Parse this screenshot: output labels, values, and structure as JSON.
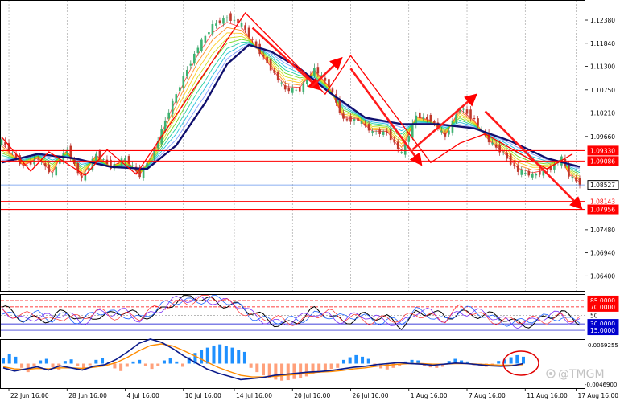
{
  "chart_data": {
    "type": "candlestick",
    "main": {
      "ylim": [
        1.0605,
        1.1285
      ],
      "y_ticks": [
        "1.12380",
        "1.11840",
        "1.11300",
        "1.10750",
        "1.10210",
        "1.09660",
        "1.08527",
        "1.07480",
        "1.06940",
        "1.06400"
      ],
      "current_price": "1.08527",
      "levels": [
        {
          "label": "1.09330",
          "value": 1.0933,
          "style": "box"
        },
        {
          "label": "1.09086",
          "value": 1.09086,
          "style": "box"
        },
        {
          "label": "1.08143",
          "value": 1.08143,
          "style": "text"
        },
        {
          "label": "1.07956",
          "value": 1.07956,
          "style": "box"
        }
      ],
      "price_path": [
        {
          "i": 0,
          "p": 1.0955
        },
        {
          "i": 6,
          "p": 1.0895
        },
        {
          "i": 10,
          "p": 1.0915
        },
        {
          "i": 14,
          "p": 1.0875
        },
        {
          "i": 16,
          "p": 1.0915
        },
        {
          "i": 18,
          "p": 1.0935
        },
        {
          "i": 22,
          "p": 1.0865
        },
        {
          "i": 26,
          "p": 1.0925
        },
        {
          "i": 30,
          "p": 1.0895
        },
        {
          "i": 34,
          "p": 1.0915
        },
        {
          "i": 38,
          "p": 1.0875
        },
        {
          "i": 42,
          "p": 1.0935
        },
        {
          "i": 46,
          "p": 1.1025
        },
        {
          "i": 50,
          "p": 1.1105
        },
        {
          "i": 54,
          "p": 1.1175
        },
        {
          "i": 58,
          "p": 1.1225
        },
        {
          "i": 62,
          "p": 1.1245
        },
        {
          "i": 66,
          "p": 1.1228
        },
        {
          "i": 70,
          "p": 1.1175
        },
        {
          "i": 74,
          "p": 1.1125
        },
        {
          "i": 78,
          "p": 1.1075
        },
        {
          "i": 82,
          "p": 1.1075
        },
        {
          "i": 86,
          "p": 1.1125
        },
        {
          "i": 90,
          "p": 1.1085
        },
        {
          "i": 94,
          "p": 1.1005
        },
        {
          "i": 98,
          "p": 1.1005
        },
        {
          "i": 102,
          "p": 1.0975
        },
        {
          "i": 106,
          "p": 1.0975
        },
        {
          "i": 110,
          "p": 1.0925
        },
        {
          "i": 114,
          "p": 1.1015
        },
        {
          "i": 118,
          "p": 1.1005
        },
        {
          "i": 122,
          "p": 1.0965
        },
        {
          "i": 126,
          "p": 1.1035
        },
        {
          "i": 130,
          "p": 1.1005
        },
        {
          "i": 134,
          "p": 1.0955
        },
        {
          "i": 138,
          "p": 1.0925
        },
        {
          "i": 142,
          "p": 1.0885
        },
        {
          "i": 146,
          "p": 1.0875
        },
        {
          "i": 150,
          "p": 1.0885
        },
        {
          "i": 154,
          "p": 1.0915
        },
        {
          "i": 156,
          "p": 1.0875
        },
        {
          "i": 159,
          "p": 1.0855
        }
      ],
      "ma_path": [
        {
          "i": 0,
          "p": 1.0905
        },
        {
          "i": 10,
          "p": 1.0925
        },
        {
          "i": 20,
          "p": 1.0915
        },
        {
          "i": 30,
          "p": 1.0895
        },
        {
          "i": 40,
          "p": 1.089
        },
        {
          "i": 48,
          "p": 1.0945
        },
        {
          "i": 56,
          "p": 1.1045
        },
        {
          "i": 62,
          "p": 1.1135
        },
        {
          "i": 68,
          "p": 1.118
        },
        {
          "i": 74,
          "p": 1.1165
        },
        {
          "i": 82,
          "p": 1.1125
        },
        {
          "i": 90,
          "p": 1.107
        },
        {
          "i": 100,
          "p": 1.101
        },
        {
          "i": 110,
          "p": 1.0995
        },
        {
          "i": 120,
          "p": 1.0995
        },
        {
          "i": 130,
          "p": 1.0985
        },
        {
          "i": 140,
          "p": 1.0955
        },
        {
          "i": 150,
          "p": 1.0915
        },
        {
          "i": 159,
          "p": 1.0895
        }
      ],
      "zigzag": [
        {
          "i": 0,
          "p": 1.0965
        },
        {
          "i": 8,
          "p": 1.0885
        },
        {
          "i": 13,
          "p": 1.093
        },
        {
          "i": 23,
          "p": 1.0875
        },
        {
          "i": 29,
          "p": 1.0935
        },
        {
          "i": 37,
          "p": 1.0878
        },
        {
          "i": 67,
          "p": 1.1255
        },
        {
          "i": 89,
          "p": 1.1065
        },
        {
          "i": 96,
          "p": 1.1155
        },
        {
          "i": 118,
          "p": 1.0905
        },
        {
          "i": 126,
          "p": 1.095
        },
        {
          "i": 133,
          "p": 1.0972
        },
        {
          "i": 150,
          "p": 1.089
        },
        {
          "i": 157,
          "p": 1.0925
        }
      ],
      "arrows": [
        {
          "from": {
            "i": 69,
            "p": 1.122
          },
          "to": {
            "i": 87,
            "p": 1.108
          }
        },
        {
          "from": {
            "i": 85,
            "p": 1.108
          },
          "to": {
            "i": 93,
            "p": 1.1145
          }
        },
        {
          "from": {
            "i": 96,
            "p": 1.1125
          },
          "to": {
            "i": 115,
            "p": 1.0905
          }
        },
        {
          "from": {
            "i": 113,
            "p": 1.0935
          },
          "to": {
            "i": 130,
            "p": 1.106
          }
        },
        {
          "from": {
            "i": 133,
            "p": 1.1025
          },
          "to": {
            "i": 159,
            "p": 1.0802
          }
        }
      ]
    },
    "oscillator": {
      "ylim": [
        0,
        100
      ],
      "levels": [
        {
          "label": "85.0000",
          "value": 85,
          "style": "box"
        },
        {
          "label": "70.0000",
          "value": 70,
          "style": "box"
        },
        {
          "label": "50",
          "value": 50,
          "style": "text"
        },
        {
          "label": "30.0000",
          "value": 30,
          "style": "box"
        },
        {
          "label": "15.0000",
          "value": 15,
          "style": "box"
        }
      ]
    },
    "macd": {
      "ylim": [
        -0.0046,
        0.0046
      ],
      "y_ticks": [
        "0.0069255",
        "-0.0046900"
      ],
      "histogram": [
        0.001,
        0.0018,
        0.0013,
        -0.0008,
        -0.0016,
        -0.0004,
        0.0006,
        0.0009,
        -0.0007,
        -0.0012,
        0.0005,
        0.0008,
        -0.0005,
        -0.0011,
        -0.0003,
        0.0007,
        0.001,
        0.0003,
        -0.0009,
        -0.0014,
        -0.0006,
        0.0004,
        0.0007,
        -0.0004,
        -0.001,
        -0.0005,
        0.0006,
        0.001,
        0.0004,
        -0.0006,
        0.0012,
        0.002,
        0.0026,
        0.003,
        0.0034,
        0.0036,
        0.0033,
        0.003,
        0.0026,
        0.0022,
        -0.0008,
        -0.0016,
        -0.0022,
        -0.0027,
        -0.003,
        -0.0032,
        -0.0031,
        -0.0029,
        -0.0027,
        -0.0024,
        -0.002,
        -0.0017,
        -0.0013,
        -0.001,
        -0.0008,
        0.0007,
        0.0012,
        0.0016,
        0.0013,
        0.0009,
        -0.0006,
        -0.0009,
        -0.0011,
        -0.0008,
        -0.0005,
        0.0004,
        0.0007,
        0.0006,
        -0.0004,
        -0.0007,
        -0.0008,
        -0.0006,
        0.0005,
        0.0009,
        0.0006,
        0.0004,
        -0.0003,
        -0.0005,
        -0.0006,
        -0.0004,
        0.0005,
        0.0008,
        0.0012,
        0.0016,
        0.0013
      ],
      "line1": [
        -0.0008,
        -0.0014,
        -0.001,
        -0.0006,
        -0.0012,
        -0.0004,
        -0.0008,
        -0.0012,
        -0.0005,
        -0.0002,
        0.0008,
        0.0022,
        0.0038,
        0.0046,
        0.004,
        0.0028,
        0.0014,
        0.0002,
        -0.001,
        -0.0018,
        -0.0024,
        -0.003,
        -0.0028,
        -0.0026,
        -0.0022,
        -0.002,
        -0.0018,
        -0.0016,
        -0.0015,
        -0.0013,
        -0.001,
        -0.0007,
        -0.0005,
        -0.0002,
        0.0,
        0.0002,
        0.0,
        -0.0001,
        -0.0003,
        -0.0001,
        0.0001,
        0.0,
        -0.0002,
        -0.0004,
        -0.0005,
        -0.0004,
        0.0
      ],
      "line2": [
        -0.0006,
        -0.001,
        -0.0011,
        -0.0009,
        -0.001,
        -0.0008,
        -0.0008,
        -0.0009,
        -0.0007,
        -0.0004,
        0.0002,
        0.0012,
        0.0024,
        0.0034,
        0.0037,
        0.0033,
        0.0024,
        0.0014,
        0.0003,
        -0.0007,
        -0.0015,
        -0.0022,
        -0.0025,
        -0.0025,
        -0.0024,
        -0.0022,
        -0.002,
        -0.0018,
        -0.0016,
        -0.0015,
        -0.0013,
        -0.001,
        -0.0008,
        -0.0005,
        -0.0003,
        -0.0001,
        0.0,
        0.0,
        -0.0001,
        -0.0001,
        0.0,
        0.0,
        -0.0001,
        -0.0002,
        -0.0003,
        -0.0003,
        -0.0002
      ]
    },
    "x_ticks": [
      "22 Jun 16:00",
      "28 Jun 16:00",
      "4 Jul 16:00",
      "10 Jul 16:00",
      "14 Jul 16:00",
      "20 Jul 16:00",
      "26 Jul 16:00",
      "1 Aug 16:00",
      "7 Aug 16:00",
      "11 Aug 16:00",
      "17 Aug 16:00"
    ],
    "x_tick_index": [
      2,
      18,
      34,
      50,
      64,
      80,
      96,
      112,
      128,
      144,
      158
    ],
    "n_bars": 160
  },
  "watermark": "@TMGM",
  "colors": {
    "level_red": "#ff0000",
    "ma_navy": "#10106e",
    "price_line": "#6495ed",
    "hist_blue": "#1e90ff",
    "hist_orange": "#ffa07a",
    "macd_orange": "#ff8c00",
    "osc_box_red": "#ff0000",
    "osc_box_blue": "#0000cd"
  }
}
